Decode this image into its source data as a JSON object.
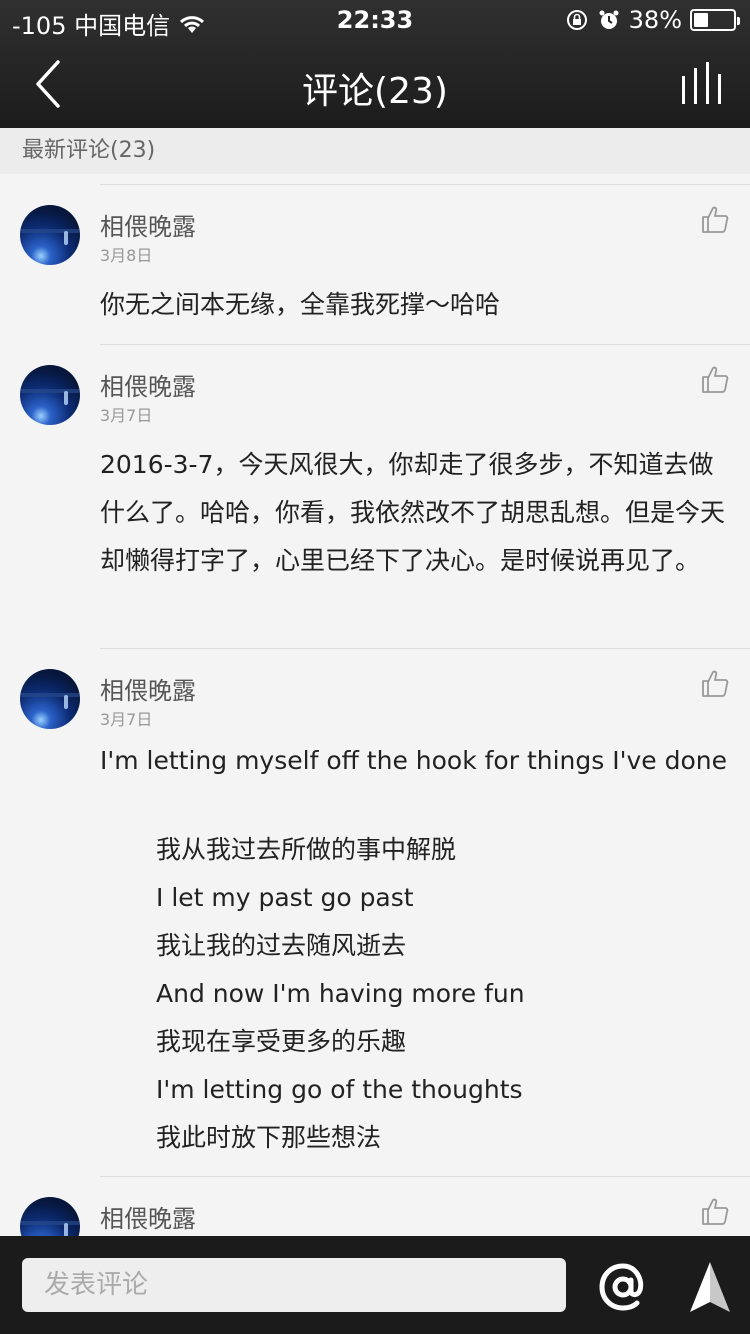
{
  "status_bar": {
    "carrier": "-105 中国电信",
    "time": "22:33",
    "battery_percent": "38%",
    "battery_level": 0.38
  },
  "nav": {
    "title": "评论(23)"
  },
  "section": {
    "header": "最新评论(23)"
  },
  "comments": [
    {
      "name": "相偎晚露",
      "date": "3月8日",
      "text": "你无之间本无缘，全靠我死撑～哈哈"
    },
    {
      "name": "相偎晚露",
      "date": "3月7日",
      "text": "2016-3-7，今天风很大，你却走了很多步，不知道去做什么了。哈哈，你看，我依然改不了胡思乱想。但是今天却懒得打字了，心里已经下了决心。是时候说再见了。"
    },
    {
      "name": "相偎晚露",
      "date": "3月7日",
      "text": "I'm letting myself off the hook for things I've done",
      "lines": [
        "我从我过去所做的事中解脱",
        "I let my past go past",
        "我让我的过去随风逝去",
        "And now I'm having more fun",
        "我现在享受更多的乐趣",
        "I'm letting go of the thoughts",
        "我此时放下那些想法"
      ]
    },
    {
      "name": "相偎晚露"
    }
  ],
  "input": {
    "placeholder": "发表评论"
  },
  "colors": {
    "header_bg": "#262626",
    "section_bg": "#ececec",
    "page_bg": "#f4f4f4",
    "bottom_bar_bg": "#1b1b1b"
  }
}
